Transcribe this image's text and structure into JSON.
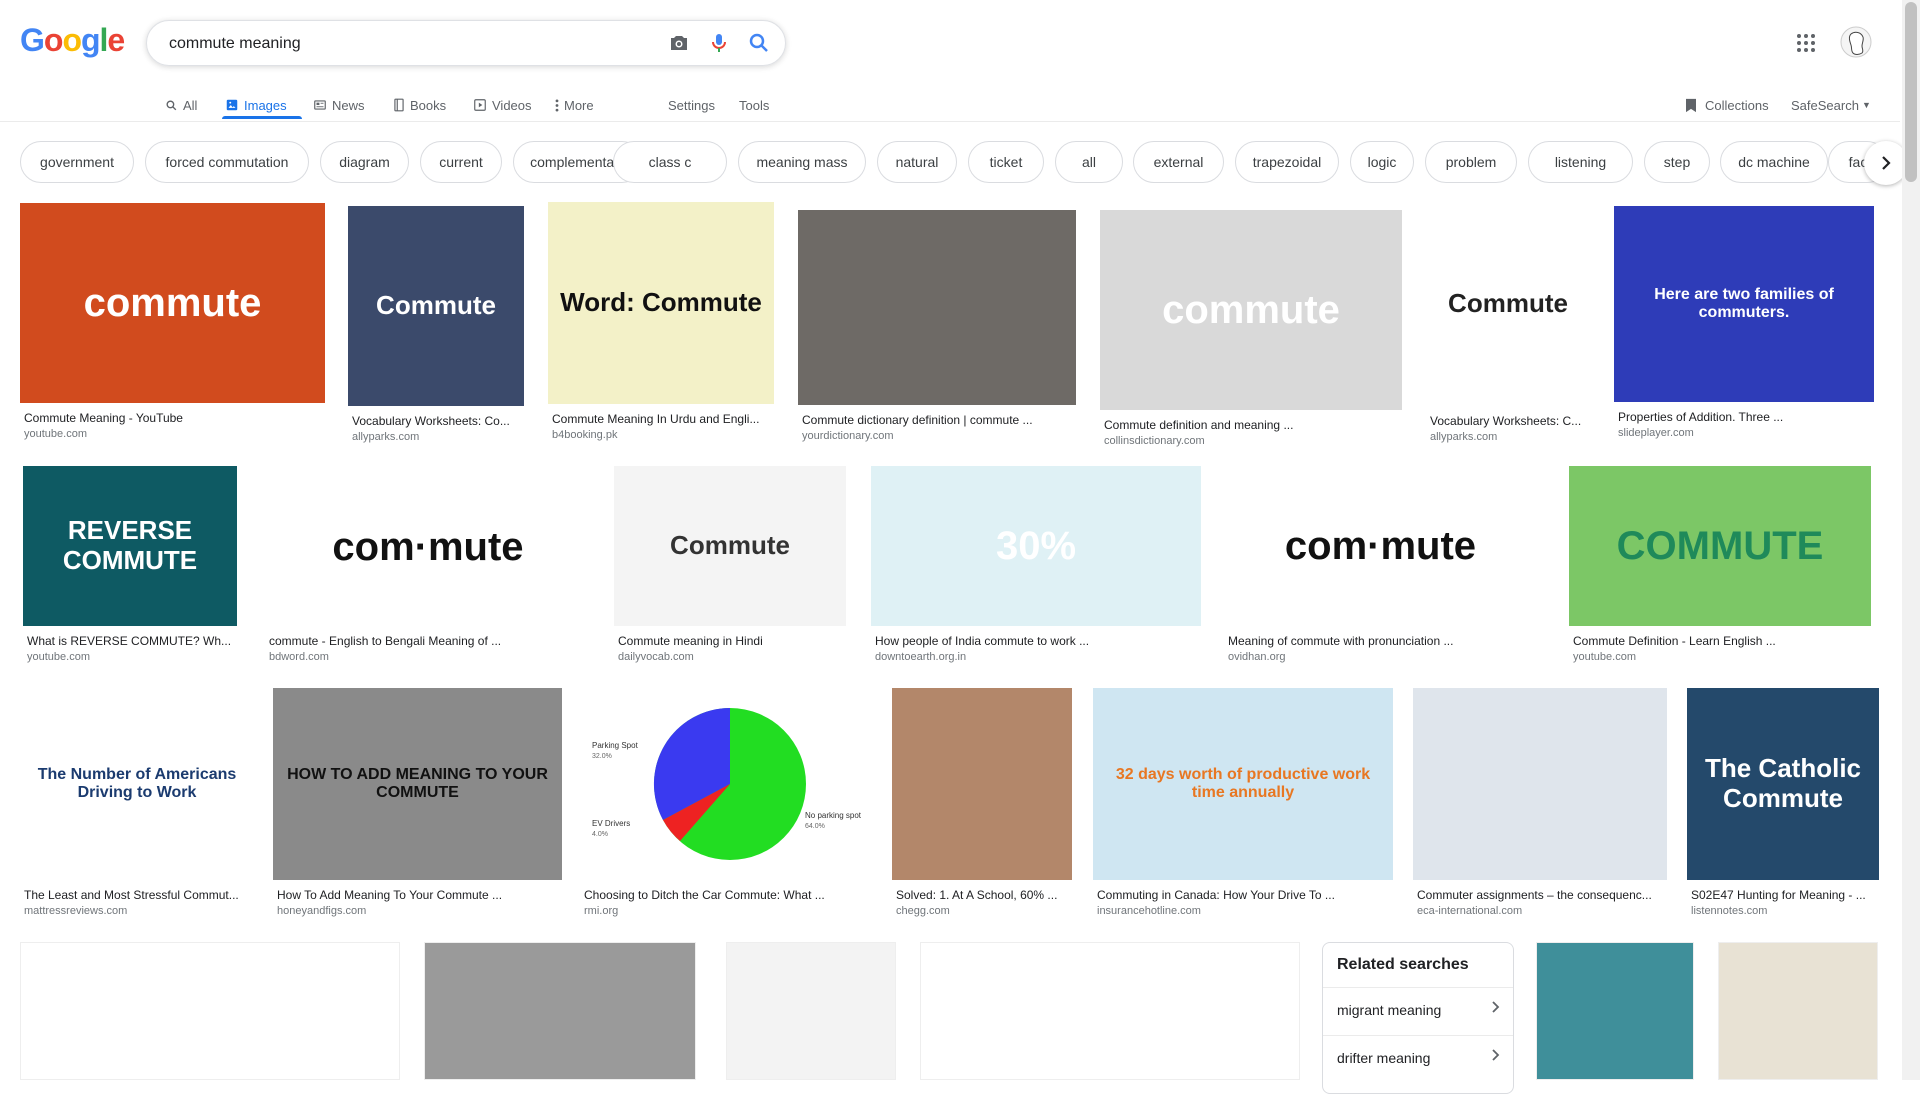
{
  "header": {
    "logo_letters": [
      {
        "ch": "G",
        "color": "#4285f4"
      },
      {
        "ch": "o",
        "color": "#ea4335"
      },
      {
        "ch": "o",
        "color": "#fbbc05"
      },
      {
        "ch": "g",
        "color": "#4285f4"
      },
      {
        "ch": "l",
        "color": "#34a853"
      },
      {
        "ch": "e",
        "color": "#ea4335"
      }
    ],
    "query": "commute meaning",
    "apps_icon": "apps-grid-icon",
    "avatar_icon": "account-avatar-icon"
  },
  "tabs": {
    "all": "All",
    "images": "Images",
    "news": "News",
    "books": "Books",
    "videos": "Videos",
    "more": "More",
    "settings": "Settings",
    "tools": "Tools",
    "collections": "Collections",
    "safesearch": "SafeSearch"
  },
  "chips": [
    "government",
    "forced commutation",
    "diagram",
    "current",
    "complementary",
    "class c",
    "meaning mass",
    "natural",
    "ticket",
    "all",
    "external",
    "trapezoidal",
    "logic",
    "problem",
    "listening",
    "step",
    "dc machine",
    "fac"
  ],
  "results": [
    {
      "title": "Commute Meaning - YouTube",
      "source": "youtube.com",
      "thumb_text": "commute",
      "bg": "#d14b1e",
      "fg": "#ffffff"
    },
    {
      "title": "Vocabulary Worksheets: Co...",
      "source": "allyparks.com",
      "thumb_text": "Commute",
      "bg": "#3b4a6b",
      "fg": "#ffffff"
    },
    {
      "title": "Commute Meaning In Urdu and Engli...",
      "source": "b4booking.pk",
      "thumb_text": "Word: Commute",
      "bg": "#f3f1c8",
      "fg": "#111111"
    },
    {
      "title": "Commute dictionary definition | commute ...",
      "source": "yourdictionary.com",
      "thumb_text": "",
      "bg": "#6e6a66",
      "fg": "#ffffff"
    },
    {
      "title": "Commute definition and meaning ...",
      "source": "collinsdictionary.com",
      "thumb_text": "commute",
      "bg": "#d9d9d9",
      "fg": "#ffffff"
    },
    {
      "title": "Vocabulary Worksheets: C...",
      "source": "allyparks.com",
      "thumb_text": "Commute",
      "bg": "#ffffff",
      "fg": "#222222"
    },
    {
      "title": "Properties of Addition. Three ...",
      "source": "slideplayer.com",
      "thumb_text": "Here are two families of commuters.",
      "bg": "#2e3cb8",
      "fg": "#ffffff"
    },
    {
      "title": "What is REVERSE COMMUTE? Wh...",
      "source": "youtube.com",
      "thumb_text": "REVERSE COMMUTE",
      "bg": "#0e5a63",
      "fg": "#ffffff"
    },
    {
      "title": "commute - English to Bengali Meaning of ...",
      "source": "bdword.com",
      "thumb_text": "com·mute",
      "bg": "#ffffff",
      "fg": "#111111"
    },
    {
      "title": "Commute meaning in Hindi",
      "source": "dailyvocab.com",
      "thumb_text": "Commute",
      "bg": "#f4f4f4",
      "fg": "#333333"
    },
    {
      "title": "How people of India commute to work ...",
      "source": "downtoearth.org.in",
      "thumb_text": "30%",
      "bg": "#dff1f5",
      "fg": "#ffffff"
    },
    {
      "title": "Meaning of commute with pronunciation ...",
      "source": "ovidhan.org",
      "thumb_text": "com·mute",
      "bg": "#ffffff",
      "fg": "#111111"
    },
    {
      "title": "Commute Definition - Learn English ...",
      "source": "youtube.com",
      "thumb_text": "COMMUTE",
      "bg": "#7cc766",
      "fg": "#1f8a5a"
    },
    {
      "title": "The Least and Most Stressful Commut...",
      "source": "mattressreviews.com",
      "thumb_text": "The Number of Americans Driving to Work",
      "bg": "#ffffff",
      "fg": "#1b3b6f"
    },
    {
      "title": "How To Add Meaning To Your Commute ...",
      "source": "honeyandfigs.com",
      "thumb_text": "HOW TO ADD MEANING TO YOUR COMMUTE",
      "bg": "#8a8a8a",
      "fg": "#111111"
    },
    {
      "title": "Choosing to Ditch the Car Commute: What ...",
      "source": "rmi.org",
      "thumb_text": "",
      "bg": "#ffffff",
      "fg": "#111111"
    },
    {
      "title": "Solved: 1. At A School, 60% ...",
      "source": "chegg.com",
      "thumb_text": "",
      "bg": "#b3876a",
      "fg": "#3a2a20"
    },
    {
      "title": "Commuting in Canada: How Your Drive To ...",
      "source": "insurancehotline.com",
      "thumb_text": "32 days worth of productive work time annually",
      "bg": "#cfe6f2",
      "fg": "#e87722"
    },
    {
      "title": "Commuter assignments – the consequenc...",
      "source": "eca-international.com",
      "thumb_text": "",
      "bg": "#dfe5ec",
      "fg": "#333333"
    },
    {
      "title": "S02E47 Hunting for Meaning - ...",
      "source": "listennotes.com",
      "thumb_text": "The Catholic Commute",
      "bg": "#24496b",
      "fg": "#ffffff"
    }
  ],
  "pie_labels": {
    "parking": "Parking Spot",
    "parking_pct": "32.0%",
    "ev": "EV Drivers",
    "ev_pct": "4.0%",
    "noparking": "No parking spot",
    "noparking_pct": "64.0%"
  },
  "related": {
    "title": "Related searches",
    "items": [
      "migrant meaning",
      "drifter meaning"
    ]
  },
  "colors": {
    "accent": "#1a73e8",
    "muted": "#70757a",
    "border": "#dadce0"
  }
}
